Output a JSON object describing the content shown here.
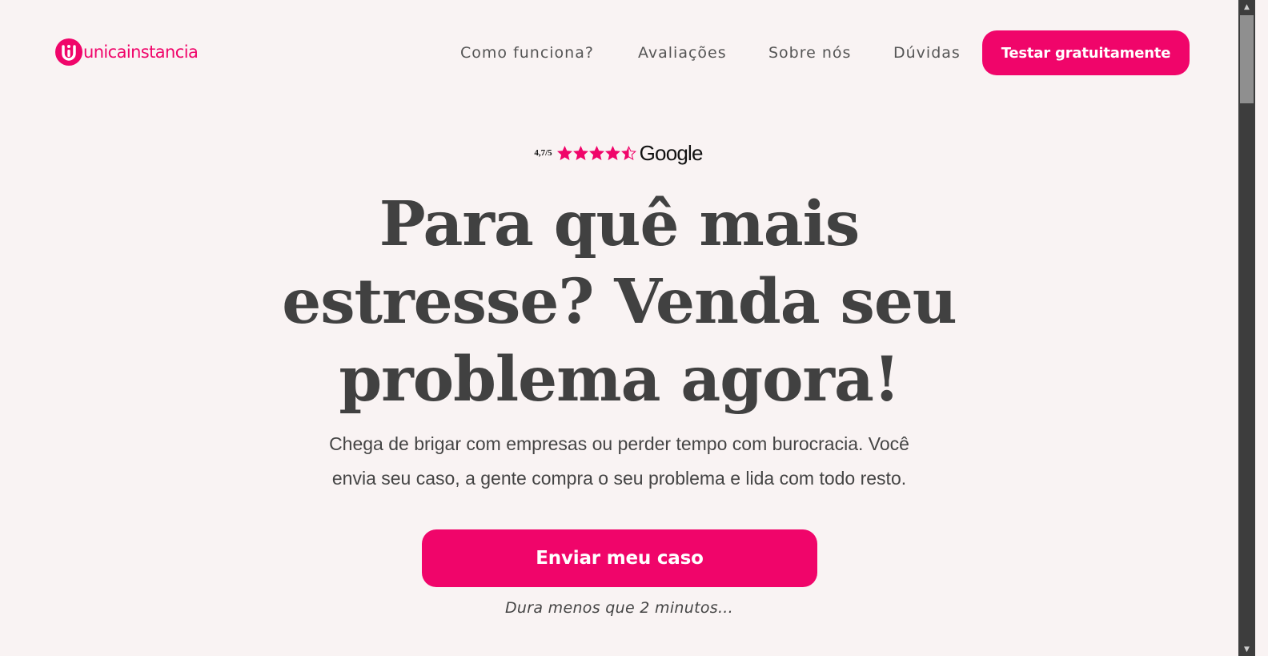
{
  "brand": {
    "name": "unicainstancia",
    "color": "#f0056a"
  },
  "nav": {
    "items": [
      "Como funciona?",
      "Avaliações",
      "Sobre nós",
      "Dúvidas"
    ],
    "cta_label": "Testar gratuitamente"
  },
  "rating": {
    "score": "4,7/5",
    "stars": 4.5,
    "max_stars": 5,
    "provider": "Google"
  },
  "hero": {
    "headline_lines": [
      "Para quê mais",
      "estresse? Venda seu",
      "problema agora!"
    ],
    "subtitle_lines": [
      "Chega de brigar com empresas ou perder tempo com burocracia. Você",
      "envia seu caso, a gente compra o seu problema e lida com todo resto."
    ],
    "cta_label": "Enviar meu caso",
    "note": "Dura menos que 2 minutos..."
  }
}
